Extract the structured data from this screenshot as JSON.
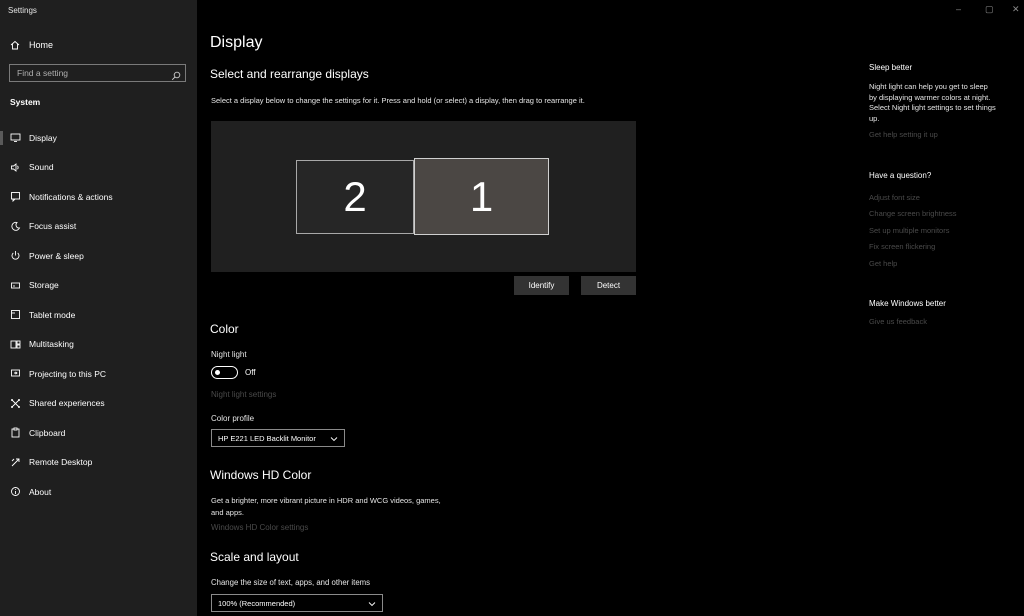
{
  "window": {
    "title": "Settings",
    "controls": [
      "–",
      "▢",
      "✕"
    ]
  },
  "sidebar": {
    "home_label": "Home",
    "search_placeholder": "Find a setting",
    "section": "System",
    "items": [
      {
        "label": "Display",
        "icon": "monitor-icon",
        "active": true
      },
      {
        "label": "Sound",
        "icon": "speaker-icon"
      },
      {
        "label": "Notifications & actions",
        "icon": "notification-icon"
      },
      {
        "label": "Focus assist",
        "icon": "moon-icon"
      },
      {
        "label": "Power & sleep",
        "icon": "power-icon"
      },
      {
        "label": "Storage",
        "icon": "storage-icon"
      },
      {
        "label": "Tablet mode",
        "icon": "tablet-icon"
      },
      {
        "label": "Multitasking",
        "icon": "multitasking-icon"
      },
      {
        "label": "Projecting to this PC",
        "icon": "projector-icon"
      },
      {
        "label": "Shared experiences",
        "icon": "shared-icon"
      },
      {
        "label": "Clipboard",
        "icon": "clipboard-icon"
      },
      {
        "label": "Remote Desktop",
        "icon": "remote-icon"
      },
      {
        "label": "About",
        "icon": "info-icon"
      }
    ]
  },
  "main": {
    "title": "Display",
    "arrange": {
      "heading": "Select and rearrange displays",
      "description": "Select a display below to change the settings for it. Press and hold (or select) a display, then drag to rearrange it.",
      "monitors": [
        "2",
        "1"
      ],
      "identify_label": "Identify",
      "detect_label": "Detect"
    },
    "color": {
      "heading": "Color",
      "night_light_label": "Night light",
      "night_light_state": "Off",
      "night_light_settings": "Night light settings",
      "profile_label": "Color profile",
      "profile_value": "HP E221 LED Backlit Monitor"
    },
    "hdr": {
      "heading": "Windows HD Color",
      "description_line1": "Get a brighter, more vibrant picture in HDR and WCG videos, games,",
      "description_line2": "and apps.",
      "settings_link": "Windows HD Color settings"
    },
    "scale": {
      "heading": "Scale and layout",
      "label": "Change the size of text, apps, and other items",
      "value": "100% (Recommended)"
    }
  },
  "right": {
    "sleep_heading": "Sleep better",
    "sleep_lines": [
      "Night light can help you get to sleep",
      "by displaying warmer colors at night.",
      "Select Night light settings to set things",
      "up."
    ],
    "sleep_link": "Get help setting it up",
    "question_heading": "Have a question?",
    "question_links": [
      "Adjust font size",
      "Change screen brightness",
      "Set up multiple monitors",
      "Fix screen flickering",
      "Get help"
    ],
    "better_heading": "Make Windows better",
    "feedback_link": "Give us feedback"
  },
  "colors": {
    "sidebar_bg": "#1f1f1f",
    "main_bg": "#000000",
    "display_area_bg": "#202020",
    "selected_monitor": "#4b4744",
    "dim_link": "#4a4a4a"
  }
}
